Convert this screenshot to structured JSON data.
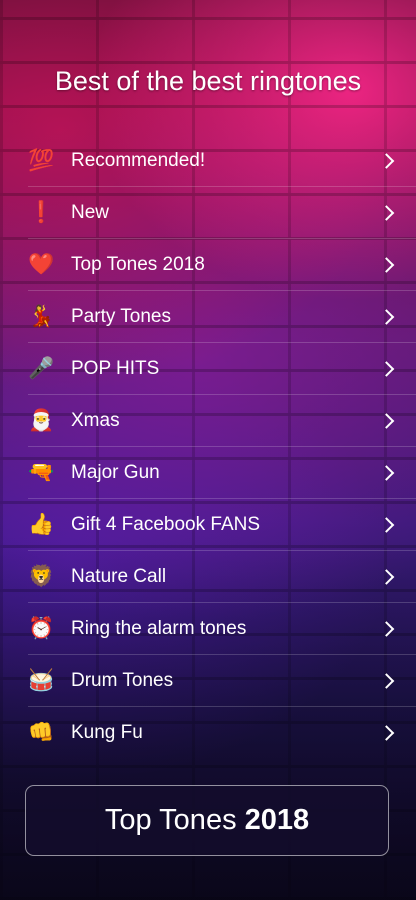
{
  "title": "Best of the best ringtones",
  "items": [
    {
      "icon": "💯",
      "icon_name": "hundred-points-icon",
      "label": "Recommended!"
    },
    {
      "icon": "❗",
      "icon_name": "exclamation-icon",
      "label": "New"
    },
    {
      "icon": "❤️",
      "icon_name": "heart-icon",
      "label": "Top Tones 2018"
    },
    {
      "icon": "💃",
      "icon_name": "dancer-icon",
      "label": "Party Tones"
    },
    {
      "icon": "🎤",
      "icon_name": "microphone-icon",
      "label": "POP HITS"
    },
    {
      "icon": "🎅",
      "icon_name": "santa-icon",
      "label": "Xmas"
    },
    {
      "icon": "🔫",
      "icon_name": "gun-icon",
      "label": "Major Gun"
    },
    {
      "icon": "👍",
      "icon_name": "thumbs-up-icon",
      "label": "Gift 4 Facebook FANS"
    },
    {
      "icon": "🦁",
      "icon_name": "lion-icon",
      "label": "Nature Call"
    },
    {
      "icon": "⏰",
      "icon_name": "alarm-clock-icon",
      "label": "Ring the alarm tones"
    },
    {
      "icon": "🥁",
      "icon_name": "drum-icon",
      "label": "Drum Tones"
    },
    {
      "icon": "👊",
      "icon_name": "fist-icon",
      "label": "Kung Fu"
    }
  ],
  "cta": {
    "text": "Top Tones",
    "bold": "2018"
  },
  "colors": {
    "accent_pink": "#ff288c",
    "background_dark": "#120c2a"
  }
}
